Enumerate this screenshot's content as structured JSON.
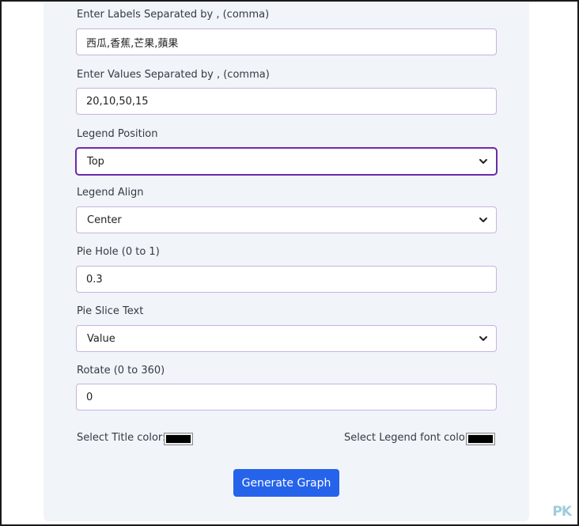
{
  "form": {
    "labels_field": {
      "label": "Enter Labels Separated by , (comma)",
      "value": "西瓜,香蕉,芒果,蘋果"
    },
    "values_field": {
      "label": "Enter Values Separated by , (comma)",
      "value": "20,10,50,15"
    },
    "legend_position": {
      "label": "Legend Position",
      "selected": "Top"
    },
    "legend_align": {
      "label": "Legend Align",
      "selected": "Center"
    },
    "pie_hole": {
      "label": "Pie Hole (0 to 1)",
      "value": "0.3"
    },
    "pie_slice_text": {
      "label": "Pie Slice Text",
      "selected": "Value"
    },
    "rotate": {
      "label": "Rotate (0 to 360)",
      "value": "0"
    },
    "title_color": {
      "label": "Select Title color:",
      "value": "#000000"
    },
    "legend_font_color": {
      "label": "Select Legend font color:",
      "value": "#000000"
    },
    "generate_button": "Generate Graph"
  },
  "watermark": "PK",
  "colors": {
    "panel_bg": "#f1f4f9",
    "field_border": "#c7b3e3",
    "focus_border": "#6d2aa8",
    "button_bg": "#2563eb",
    "button_text": "#ffffff"
  },
  "icons": {
    "select_arrow": "chevron-down-icon"
  }
}
